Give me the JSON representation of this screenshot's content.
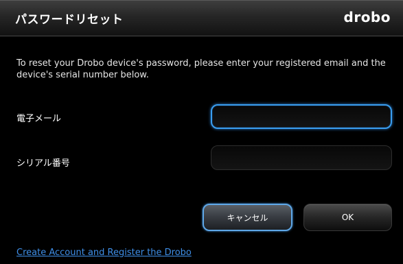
{
  "window": {
    "title": "パスワードリセット",
    "brand": "drobo"
  },
  "form": {
    "description": "To reset your Drobo device's password, please enter your registered email and the device's serial number below.",
    "email_label": "電子メール",
    "email_value": "",
    "serial_label": "シリアル番号",
    "serial_value": ""
  },
  "buttons": {
    "cancel_label": "キャンセル",
    "ok_label": "OK"
  },
  "footer": {
    "link_text": "Create Account and Register the Drobo"
  },
  "colors": {
    "accent_focus": "#3a9ef0",
    "link": "#3f8fe8"
  }
}
